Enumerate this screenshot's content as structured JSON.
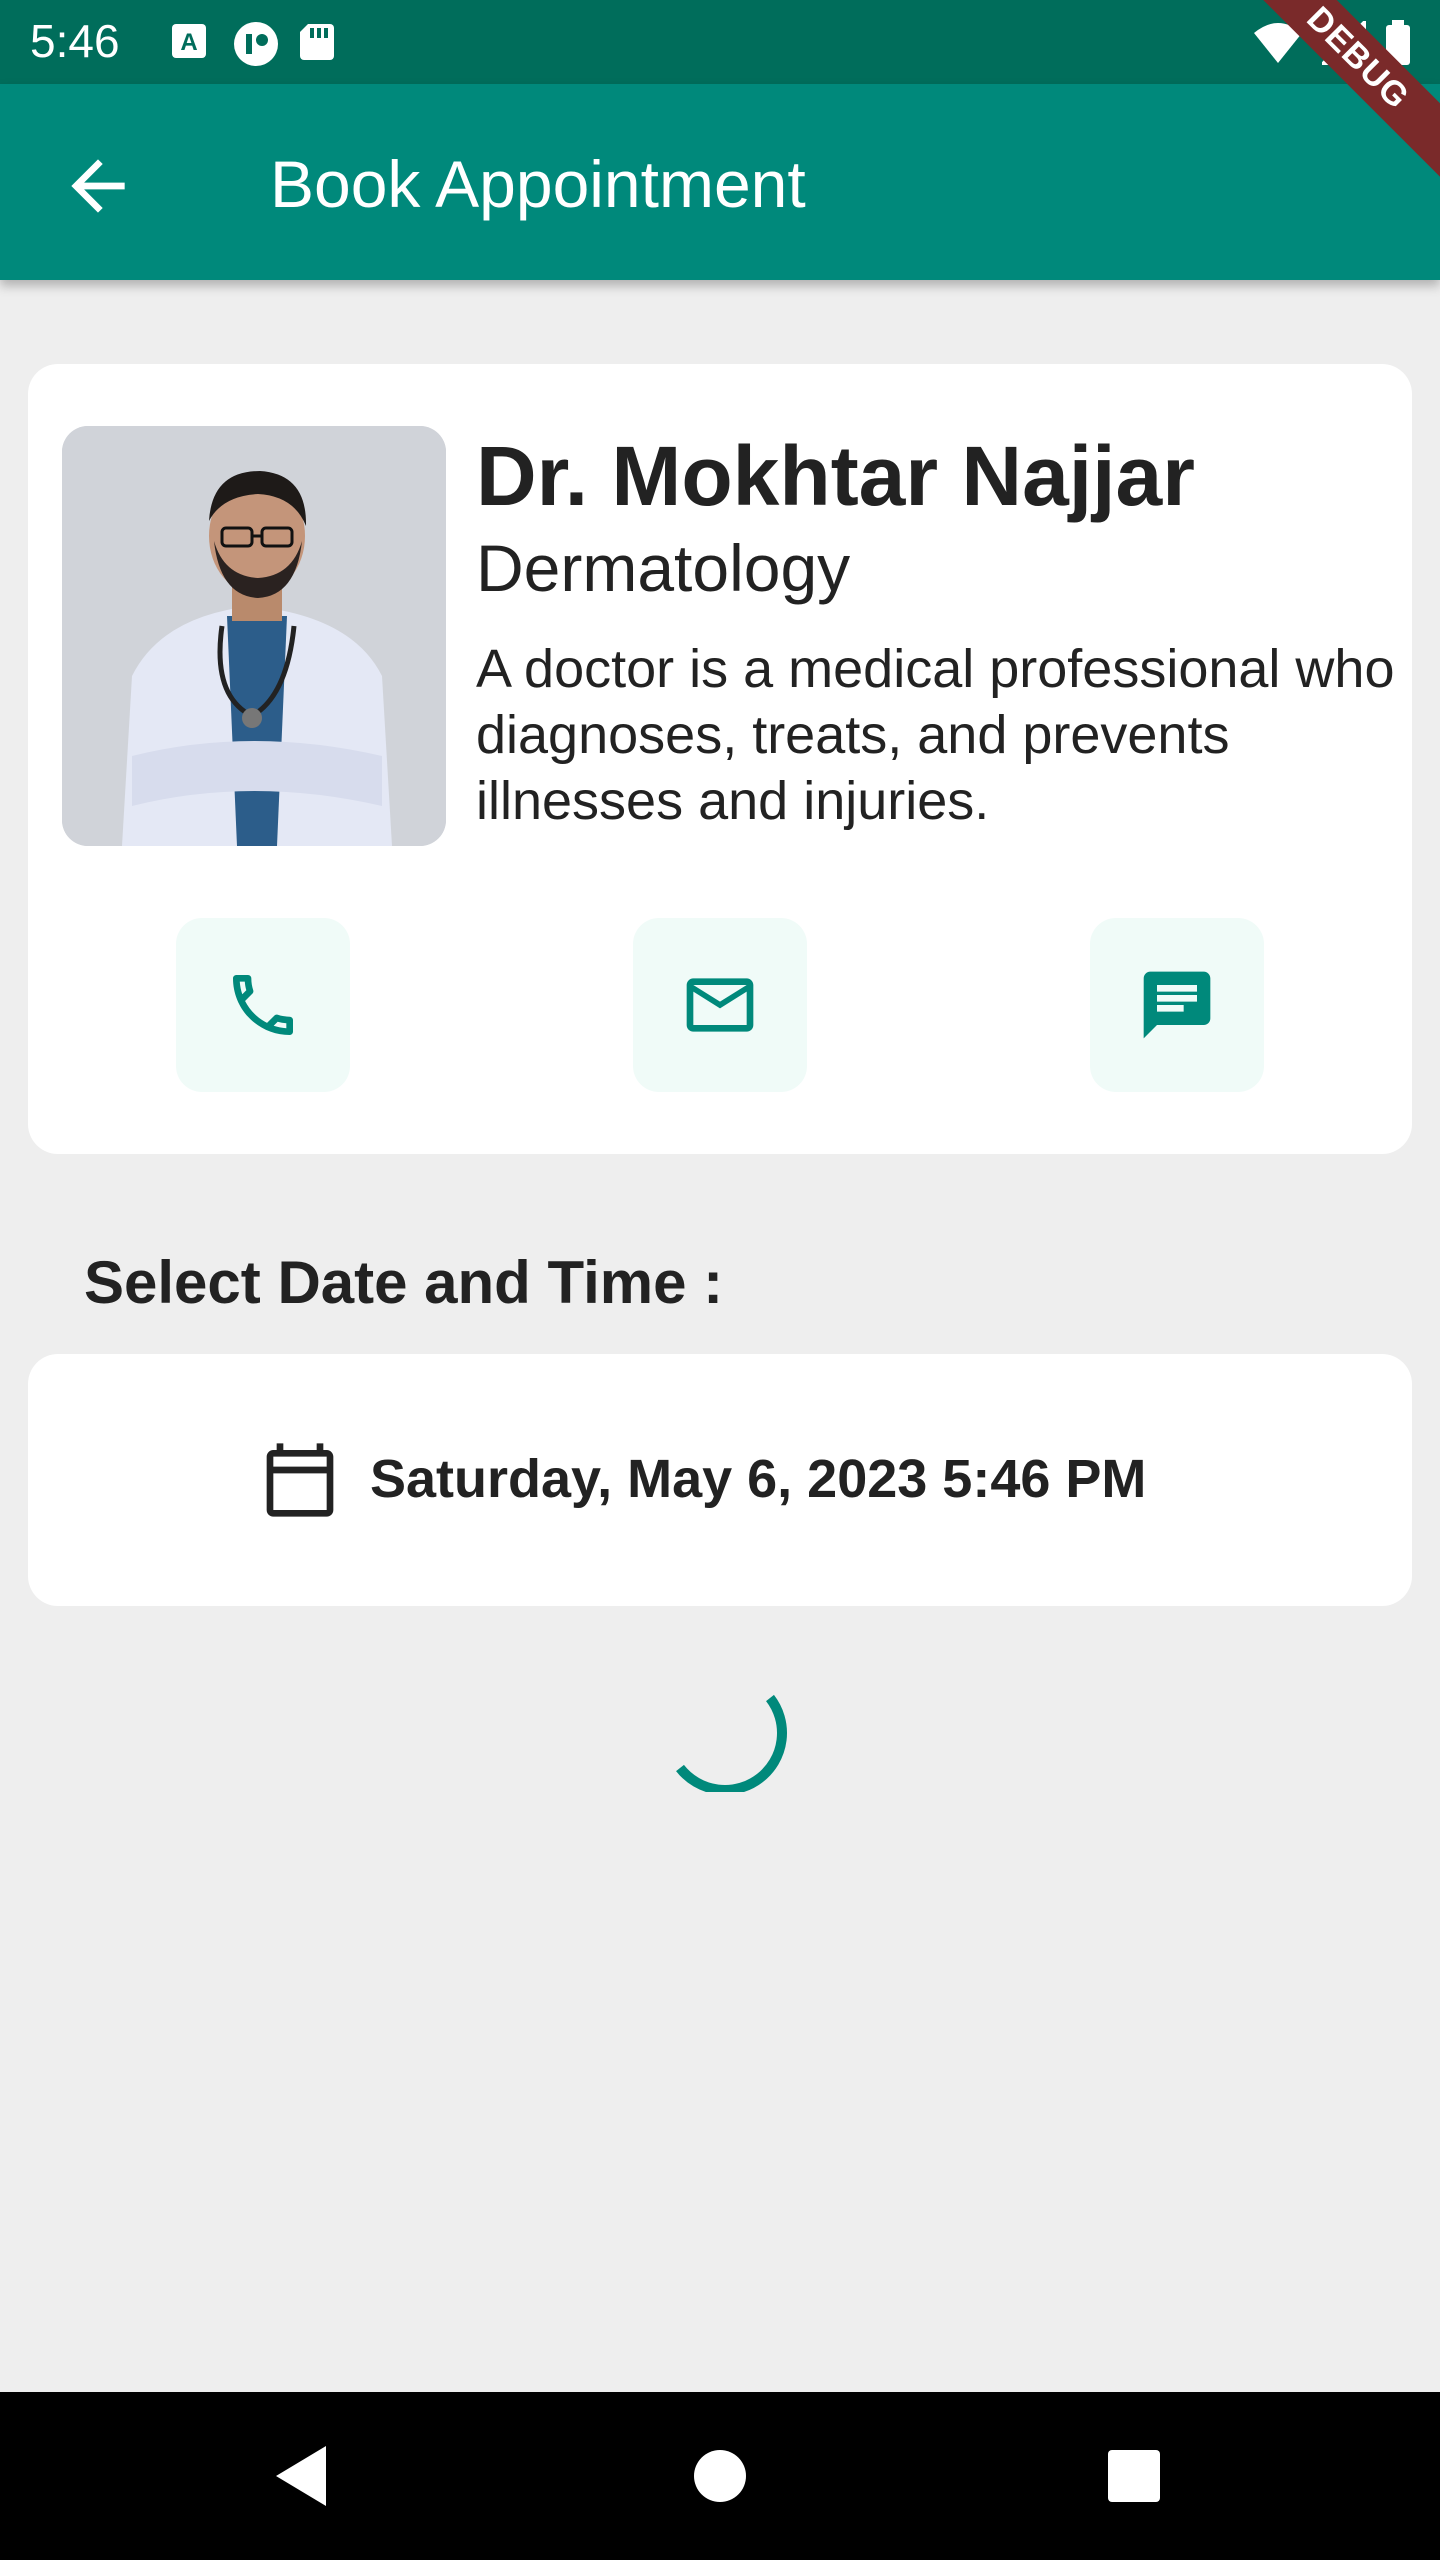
{
  "status_bar": {
    "time": "5:46",
    "left_icons": [
      "text-a-icon",
      "notification-icon",
      "sd-card-icon"
    ],
    "right_icons": [
      "wifi-icon",
      "signal-icon",
      "battery-icon"
    ]
  },
  "app_bar": {
    "title": "Book Appointment",
    "back_icon": "arrow-back-icon",
    "debug_banner": "DEBUG"
  },
  "doctor": {
    "name": "Dr. Mokhtar Najjar",
    "specialty": "Dermatology",
    "description": "A doctor is a medical professional who diagnoses, treats, and prevents illnesses and injuries.",
    "contact_buttons": [
      "phone-icon",
      "email-icon",
      "message-icon"
    ]
  },
  "schedule": {
    "section_title": "Select Date and Time :",
    "selected_datetime": "Saturday, May 6, 2023 5:46 PM"
  },
  "colors": {
    "primary": "#00897b",
    "primary_dark": "#006d5b",
    "accent_light": "#f0fbf8",
    "background": "#eeeeee"
  },
  "nav_bar": {
    "icons": [
      "back-triangle-icon",
      "home-circle-icon",
      "recents-square-icon"
    ]
  }
}
